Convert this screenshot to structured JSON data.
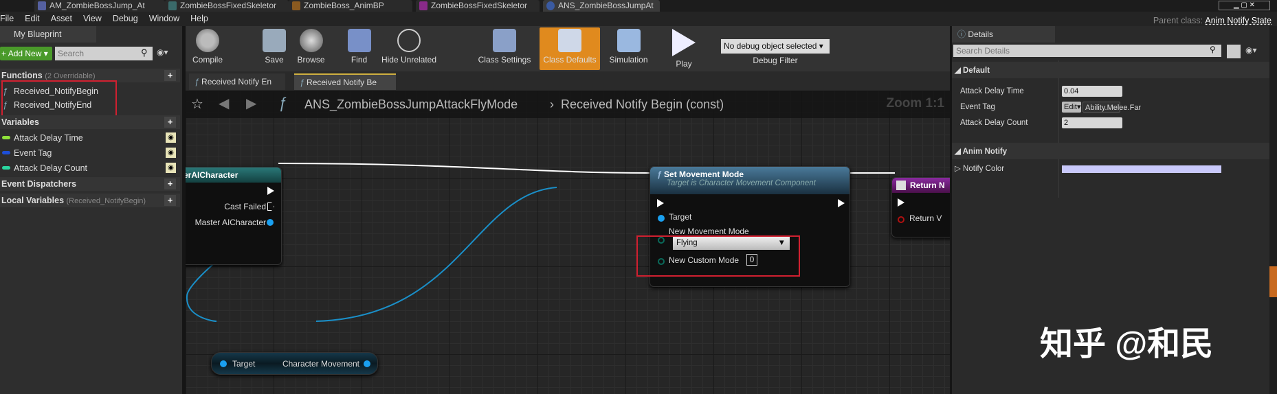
{
  "window_tabs": [
    "AM_ZombieBossJump_At",
    "ZombieBossFixedSkeletor",
    "ZombieBoss_AnimBP",
    "ZombieBossFixedSkeletor",
    "ANS_ZombieBossJumpAt"
  ],
  "menu": [
    "File",
    "Edit",
    "Asset",
    "View",
    "Debug",
    "Window",
    "Help"
  ],
  "parent_class": {
    "label": "Parent class:",
    "value": "Anim Notify State"
  },
  "my_blueprint": {
    "tab": "My Blueprint",
    "add_new": "Add New",
    "search_placeholder": "Search",
    "functions": {
      "label": "Functions",
      "sub": "(2 Overridable)",
      "items": [
        "Received_NotifyBegin",
        "Received_NotifyEnd"
      ]
    },
    "variables": {
      "label": "Variables",
      "items": [
        {
          "name": "Attack Delay Time",
          "color": "#8fe03a"
        },
        {
          "name": "Event Tag",
          "color": "#1d4fd8"
        },
        {
          "name": "Attack Delay Count",
          "color": "#2ad6a0"
        }
      ]
    },
    "event_dispatchers": "Event Dispatchers",
    "local_variables": {
      "label": "Local Variables",
      "sub": "(Received_NotifyBegin)"
    }
  },
  "toolbar": {
    "compile": "Compile",
    "save": "Save",
    "browse": "Browse",
    "find": "Find",
    "hide_unrelated": "Hide Unrelated",
    "class_settings": "Class Settings",
    "class_defaults": "Class Defaults",
    "simulation": "Simulation",
    "play": "Play",
    "debug_object": "No debug object selected",
    "debug_filter": "Debug Filter"
  },
  "graph_tabs": [
    "Received Notify En",
    "Received Notify Be"
  ],
  "breadcrumb": {
    "blueprint": "ANS_ZombieBossJumpAttackFlyMode",
    "function": "Received Notify Begin (const)",
    "zoom": "Zoom 1:1"
  },
  "nodes": {
    "cast": {
      "title": "erAICharacter",
      "cast_failed": "Cast Failed",
      "output": "Master AICharacter"
    },
    "set_movement": {
      "title": "Set Movement Mode",
      "subtitle": "Target is Character Movement Component",
      "target": "Target",
      "new_mode": "New Movement Mode",
      "mode_value": "Flying",
      "custom_mode": "New Custom Mode",
      "custom_value": "0"
    },
    "return": {
      "title": "Return N",
      "return_value": "Return V"
    },
    "get_component": {
      "input": "Target",
      "output": "Character Movement"
    }
  },
  "details": {
    "tab": "Details",
    "search_placeholder": "Search Details",
    "default": {
      "label": "Default",
      "rows": [
        {
          "name": "Attack Delay Time",
          "value": "0.04"
        },
        {
          "name": "Event Tag",
          "edit": "Edit",
          "value": "Ability.Melee.Far"
        },
        {
          "name": "Attack Delay Count",
          "value": "2"
        }
      ]
    },
    "anim_notify": {
      "label": "Anim Notify",
      "notify_color_label": "Notify Color",
      "notify_color": "#c8c8fa"
    }
  },
  "watermark": "知乎 @和民"
}
